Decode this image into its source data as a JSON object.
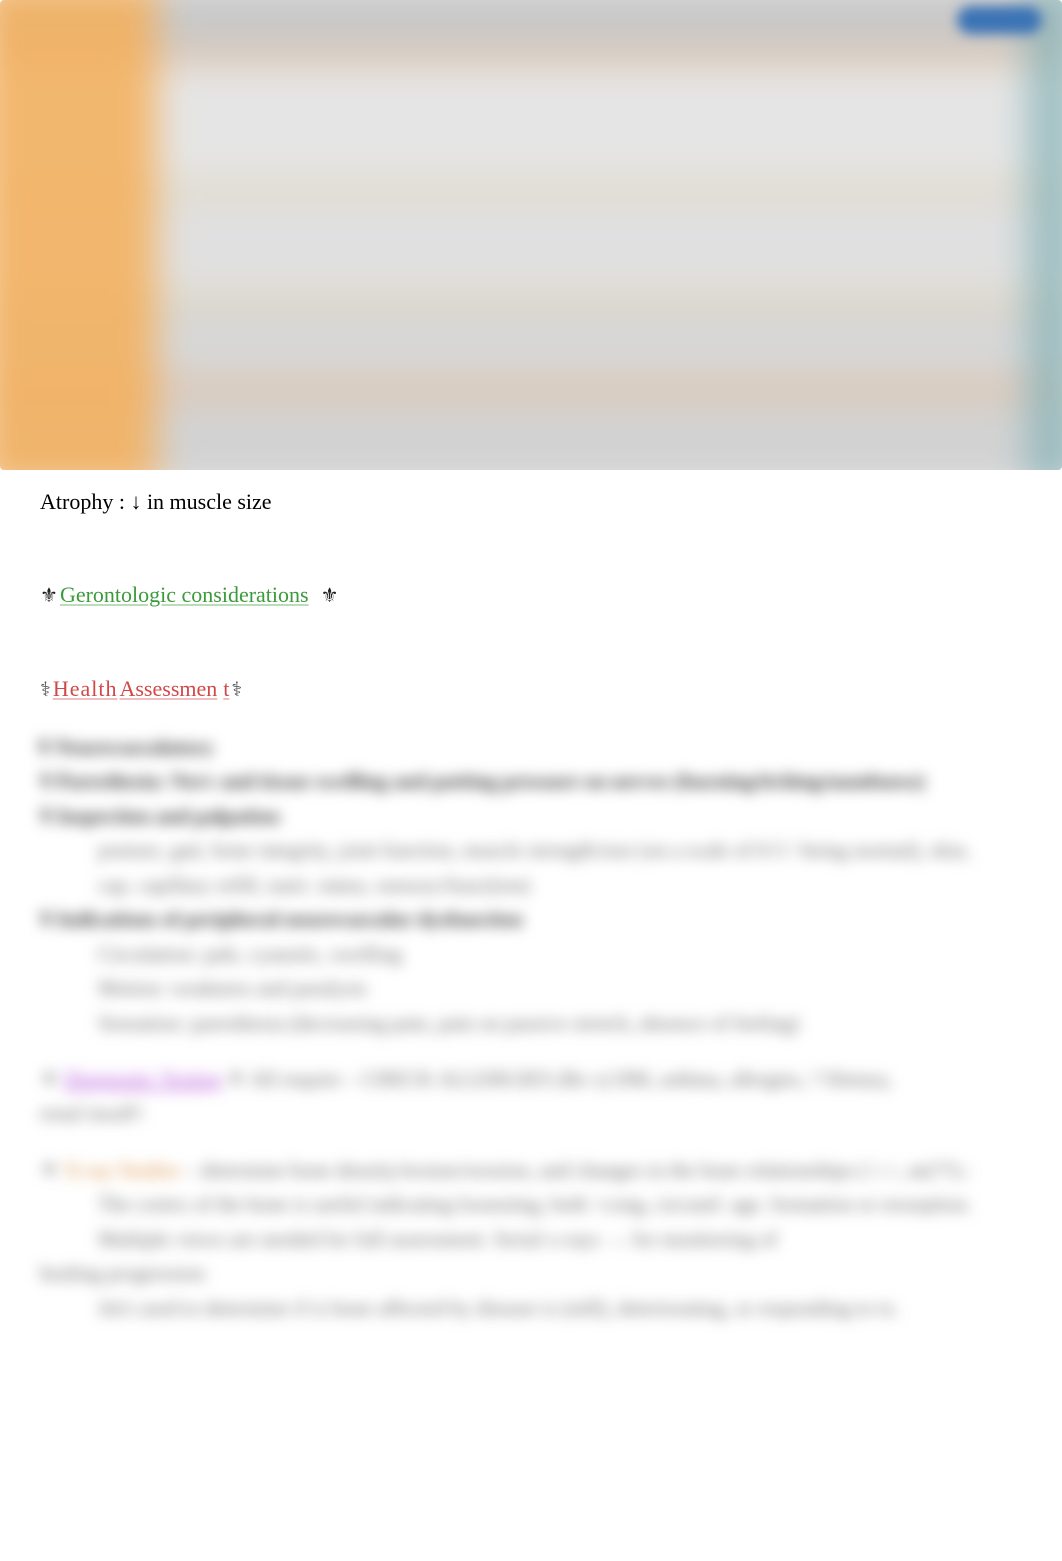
{
  "note": {
    "atrophy_line": "Atrophy : ↓ in muscle size"
  },
  "sections": {
    "gerontologic": {
      "icon": "⚜",
      "label": "Gerontologic considerations",
      "icon_trail": "⚜"
    },
    "health_assessment": {
      "icon": "⚕",
      "label_a": "Health",
      "label_b": "Assessmen",
      "label_c": "t",
      "icon_trail": "⚕"
    }
  },
  "blurred_blocks": {
    "b1": "⚕  Neurovasculatory",
    "b2": "⚕ Paresthesia: Nerv and tissue swelling and putting pressure on nerves (burning/itching/numbness)",
    "b3": "⚕ Inspection and palpation",
    "b3a": "posture, gait, bone integrity, joint function, muscle strength/size (on a scale of 0-5 / being normal), skin,",
    "b3b": "cap. capillary refill, nutri. status, sensory/func(tion)",
    "b4": "⚕ Indications of peripheral neurovascular dysfunction",
    "b4a": "Circulation: pale, cyanotic, swelling",
    "b4b": "Motion: weakness and paralysis",
    "b4c": "Sensation: paresthesia (decreasing pain, pain on passive stretch, absence of feeling)",
    "b5_pre": "⚜",
    "b5_mid": "Diagnostic Testing",
    "b5_post": "⚜ All require – CHECK ALLERGIES (Re x) DM, asthma, allergies, ? Dietary,",
    "b5_line2": "renal insuff↑",
    "b6_pre": "⚜",
    "b6_mid": "X-ray Studies",
    "b6_post": "– determine bone density/texture/erosion, and changes in the bone relationships (↑↓↑, ae(??).:",
    "b6a": "The cortex of the bone is useful indicating loosening, both ↑cong, circumf. age. formation or resorption.",
    "b6b": "Multiple views are needed for full assessment. Serial x-rays → for monitoring of",
    "b6c": "healing progression",
    "b6d": "Jnt's used to determine if is bone affected by disease is (still), deteriorating, or responding to tx."
  }
}
